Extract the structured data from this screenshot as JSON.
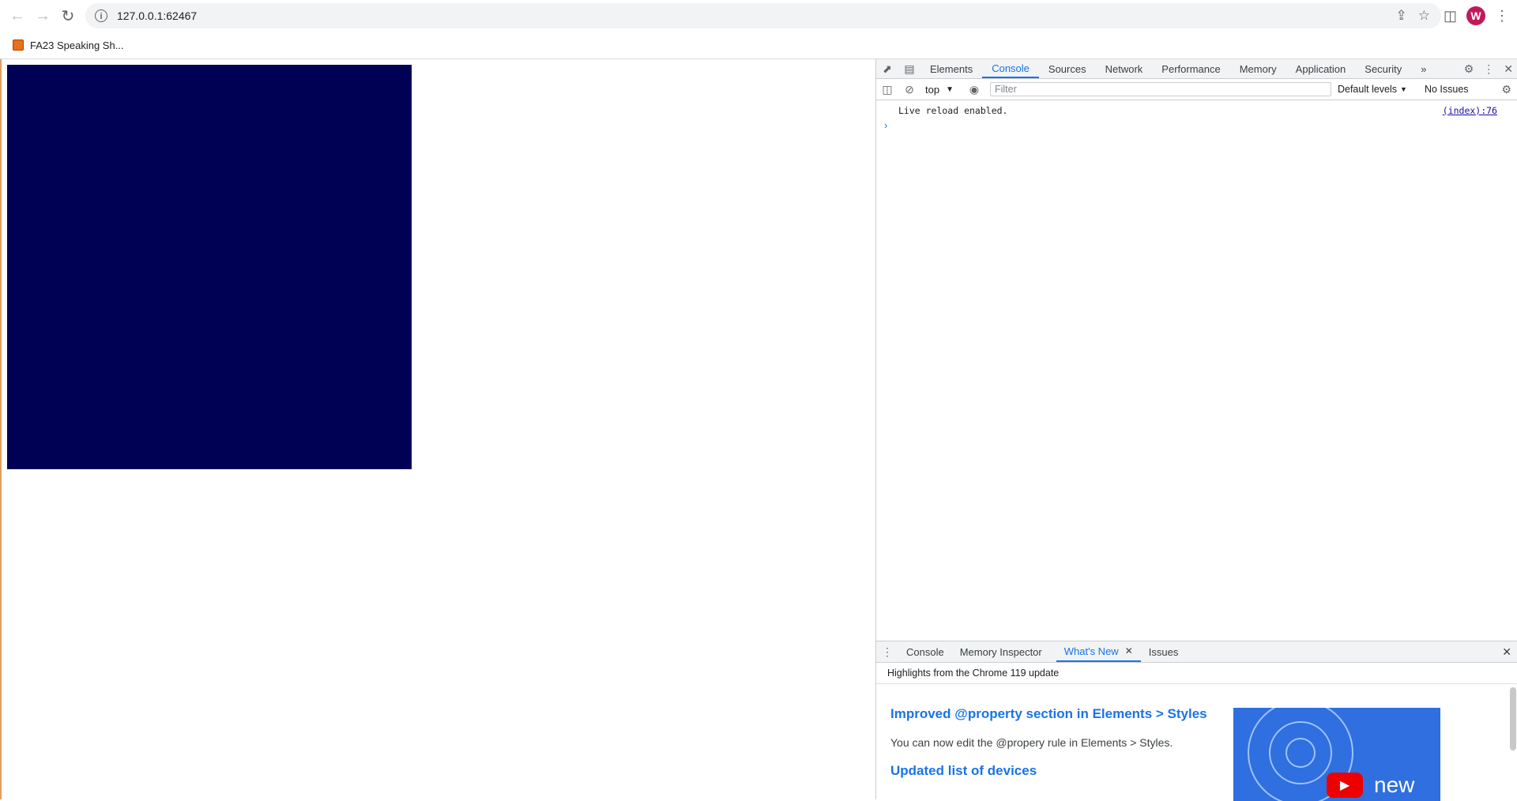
{
  "browser": {
    "url": "127.0.0.1:62467",
    "avatar_letter": "W",
    "bookmark_label": "FA23 Speaking Sh...",
    "icons": [
      "back-arrow-icon",
      "forward-arrow-icon",
      "reload-icon",
      "site-info-icon",
      "share-icon",
      "bookmark-star-icon",
      "side-panel-icon",
      "more-vert-icon"
    ]
  },
  "page": {
    "box_color": "#000055"
  },
  "devtools": {
    "tabs": [
      "Elements",
      "Console",
      "Sources",
      "Network",
      "Performance",
      "Memory",
      "Application",
      "Security"
    ],
    "active_tab": "Console",
    "more_tabs": "»",
    "context": "top",
    "filter_placeholder": "Filter",
    "levels": "Default levels",
    "issues": "No Issues",
    "console": {
      "message": "Live reload enabled.",
      "source": "(index):76"
    },
    "drawer": {
      "tabs": [
        "Console",
        "Memory Inspector",
        "What's New",
        "Issues"
      ],
      "active_tab": "What's New",
      "subtitle": "Highlights from the Chrome 119 update",
      "heading1": "Improved @property section in Elements > Styles",
      "para1": "You can now edit the @propery rule in Elements > Styles.",
      "heading2": "Updated list of devices",
      "thumb_text": "new"
    }
  },
  "colors": {
    "accent": "#1a73e8",
    "avatar": "#c2185b"
  }
}
